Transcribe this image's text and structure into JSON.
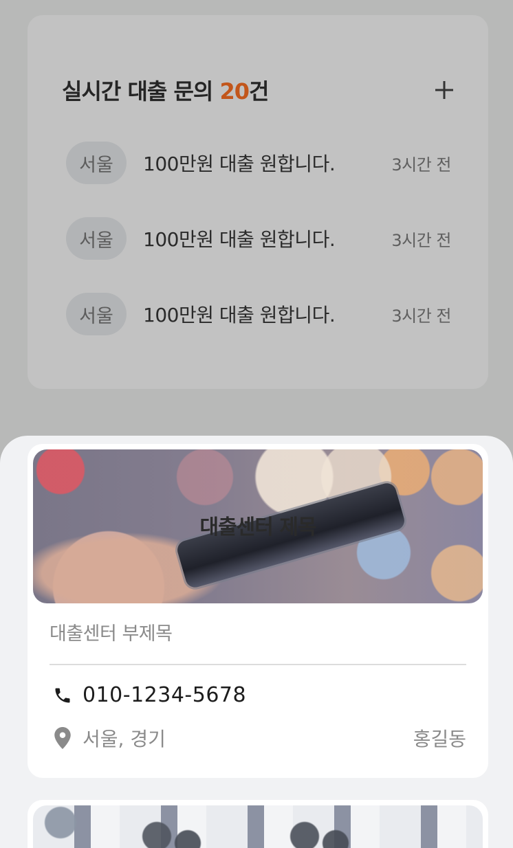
{
  "inquiry": {
    "title_prefix": "실시간 대출 문의 ",
    "count": "20",
    "title_suffix": "건",
    "items": [
      {
        "region": "서울",
        "text": "100만원 대출 원합니다.",
        "time": "3시간 전"
      },
      {
        "region": "서울",
        "text": "100만원 대출 원합니다.",
        "time": "3시간 전"
      },
      {
        "region": "서울",
        "text": "100만원 대출 원합니다.",
        "time": "3시간 전"
      }
    ]
  },
  "center_card": {
    "banner_title": "대출센터 제목",
    "subtitle": "대출센터 부제목",
    "phone": "010-1234-5678",
    "region": "서울, 경기",
    "manager": "홍길동",
    "phone_icon": "phone-icon",
    "location_icon": "location-pin-icon"
  },
  "colors": {
    "accent": "#c2561b",
    "overlay_bg": "#b8b9b8",
    "sheet_bg": "#f1f2f4"
  }
}
